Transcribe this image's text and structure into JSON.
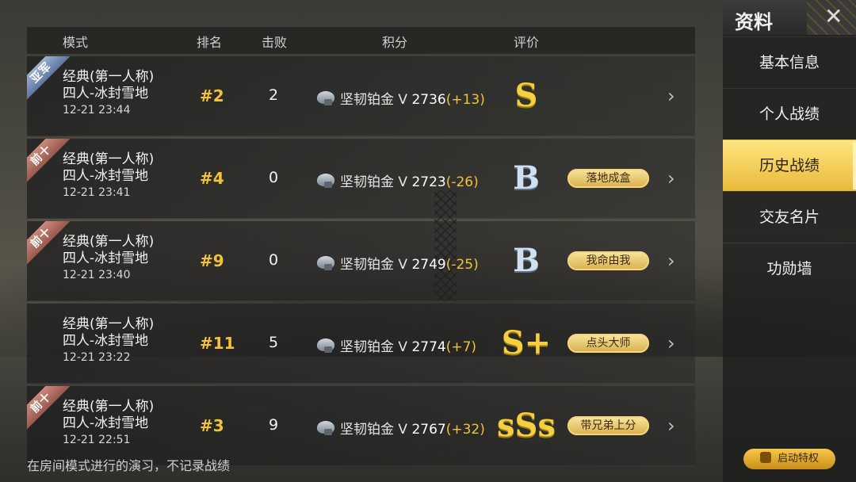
{
  "header": {
    "mode": "模式",
    "rank": "排名",
    "kills": "击败",
    "score": "积分",
    "rating": "评价"
  },
  "rows": [
    {
      "ribbon": "亚军",
      "ribbon_color": "#7d93b8",
      "mode": "经典(第一人称)",
      "map": "四人-冰封雪地",
      "time": "12-21 23:44",
      "rank": "#2",
      "kills": "2",
      "tier": "坚韧铂金 V",
      "points": "2736",
      "delta": "(+13)",
      "grade": "S",
      "grade_color": "gold",
      "tag": ""
    },
    {
      "ribbon": "前十",
      "ribbon_color": "#b06b5e",
      "mode": "经典(第一人称)",
      "map": "四人-冰封雪地",
      "time": "12-21 23:41",
      "rank": "#4",
      "kills": "0",
      "tier": "坚韧铂金 V",
      "points": "2723",
      "delta": "(-26)",
      "grade": "B",
      "grade_color": "silver",
      "tag": "落地成盒"
    },
    {
      "ribbon": "前十",
      "ribbon_color": "#b06b5e",
      "mode": "经典(第一人称)",
      "map": "四人-冰封雪地",
      "time": "12-21 23:40",
      "rank": "#9",
      "kills": "0",
      "tier": "坚韧铂金 V",
      "points": "2749",
      "delta": "(-25)",
      "grade": "B",
      "grade_color": "silver",
      "tag": "我命由我"
    },
    {
      "ribbon": "",
      "ribbon_color": "",
      "mode": "经典(第一人称)",
      "map": "四人-冰封雪地",
      "time": "12-21 23:22",
      "rank": "#11",
      "kills": "5",
      "tier": "坚韧铂金 V",
      "points": "2774",
      "delta": "(+7)",
      "grade": "S+",
      "grade_color": "gold",
      "tag": "点头大师"
    },
    {
      "ribbon": "前十",
      "ribbon_color": "#b06b5e",
      "mode": "经典(第一人称)",
      "map": "四人-冰封雪地",
      "time": "12-21 22:51",
      "rank": "#3",
      "kills": "9",
      "tier": "坚韧铂金 V",
      "points": "2767",
      "delta": "(+32)",
      "grade": "sSs",
      "grade_color": "gold",
      "tag": "带兄弟上分"
    }
  ],
  "footnote": "在房间模式进行的演习，不记录战绩",
  "sidebar": {
    "title": "资料",
    "items": [
      "基本信息",
      "个人战绩",
      "历史战绩",
      "交友名片",
      "功勋墙"
    ],
    "active": "历史战绩"
  },
  "privilege_button": "启动特权"
}
